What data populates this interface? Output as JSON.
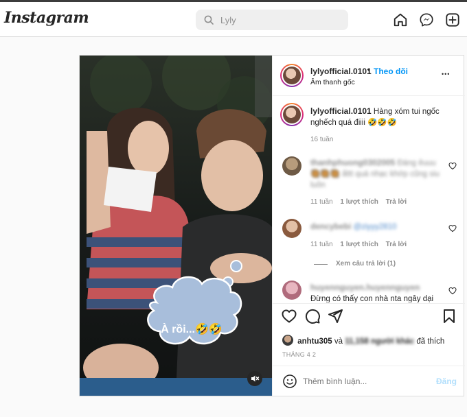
{
  "nav": {
    "logo": "Instagram",
    "search_placeholder": "Lyly",
    "icons": [
      "home-icon",
      "messenger-icon",
      "new-post-icon"
    ]
  },
  "post": {
    "author": "lylyofficial.0101",
    "separator": "•",
    "follow_label": "Theo dõi",
    "audio": "Âm thanh gốc",
    "more_label": "•••",
    "caption_text": "Hàng xóm tui ngốc nghếch quá điiii 🤣🤣🤣",
    "caption_time": "16 tuần",
    "video_overlay_text": "À rồi...🤣🤣",
    "comments": [
      {
        "user": "thanhphuong0302005",
        "text": "Đáng êuuu 🥘🥘🥘 ấttt quá nhạc khớp cũng siu luôn",
        "time": "11 tuần",
        "likes": "1 lượt thích",
        "reply": "Trả lời"
      },
      {
        "user": "dencybebi",
        "text": "@ziyyy2810",
        "time": "11 tuần",
        "likes": "1 lượt thích",
        "reply": "Trả lời",
        "view_replies": "Xem câu trả lời (1)"
      },
      {
        "user": "huyennguyen.huyennguyen",
        "text": "Đừng có thấy con nhà nta ngây dại ra rồi"
      }
    ],
    "liked_by_user": "anhtu305",
    "liked_by_and": "và",
    "liked_by_others": "11,158 người khác",
    "liked_by_suffix": "đã thích",
    "date": "THÁNG 4 2",
    "comment_placeholder": "Thêm bình luận...",
    "post_button": "Đăng"
  },
  "colors": {
    "accent": "#0095f6",
    "text": "#262626",
    "muted": "#8e8e8e",
    "border": "#dbdbdb"
  }
}
